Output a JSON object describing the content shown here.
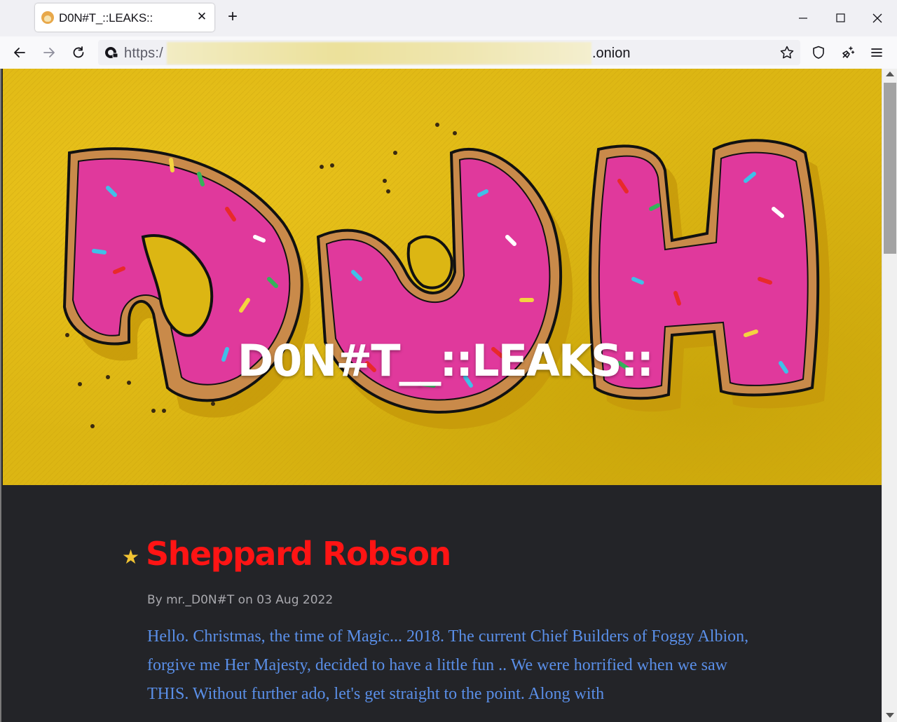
{
  "browser": {
    "tab_title": "D0N#T_::LEAKS::",
    "tab_favicon": "onion-avatar-icon",
    "url_prefix": "https:/",
    "url_suffix": ".onion"
  },
  "hero": {
    "title": "D0N#T__::LEAKS::",
    "artwork_text": "DOH"
  },
  "post": {
    "title": "Sheppard Robson",
    "meta": "By mr._D0N#T on 03 Aug 2022",
    "body": "Hello. Christmas, the time of Magic... 2018. The current Chief Builders of Foggy Albion, forgive me Her Majesty, decided to have a little fun .. We were horrified when we saw THIS. Without further ado, let's get straight to the point. Along with"
  },
  "colors": {
    "hero_background": "#dcb613",
    "donut_glaze": "#e0399c",
    "page_background": "#232428",
    "post_title": "#ff1414",
    "post_body": "#5a8fe8",
    "star": "#f2c433"
  }
}
